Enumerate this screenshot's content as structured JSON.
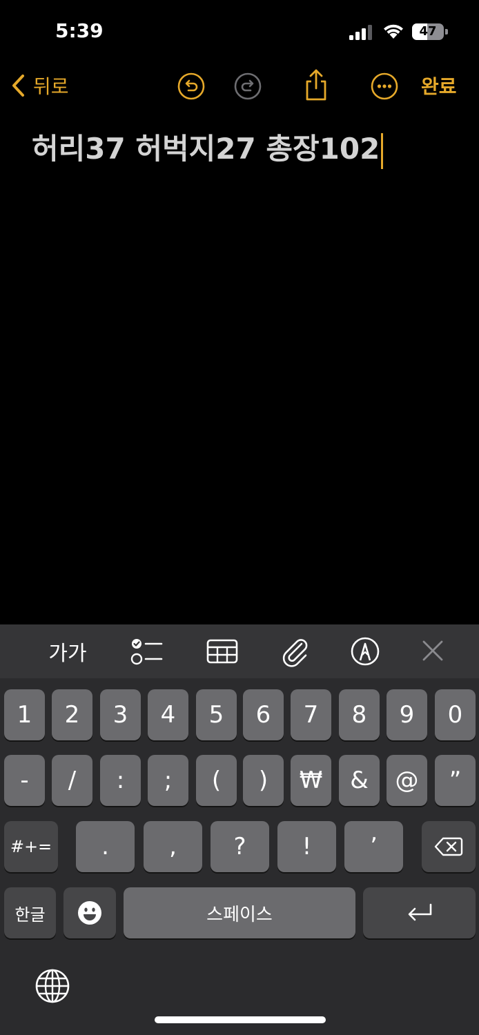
{
  "status_bar": {
    "time": "5:39",
    "battery_percent": "47",
    "battery_level": 0.47
  },
  "nav": {
    "back_label": "뒤로",
    "done_label": "완료",
    "accent_color": "#e6a92a"
  },
  "note": {
    "text": "허리37 허벅지27 총장102"
  },
  "toolbar": {
    "format_label": "가가",
    "icons": [
      "text-format-icon",
      "checklist-icon",
      "table-icon",
      "attachment-icon",
      "markup-pen-icon",
      "close-icon"
    ]
  },
  "keyboard": {
    "row1": [
      "1",
      "2",
      "3",
      "4",
      "5",
      "6",
      "7",
      "8",
      "9",
      "0"
    ],
    "row2": [
      "-",
      "/",
      ":",
      ";",
      "(",
      ")",
      "₩",
      "&",
      "@",
      "”"
    ],
    "row3_toggle": "#+=",
    "row3": [
      ".",
      ",",
      "?",
      "!",
      "’"
    ],
    "language": "한글",
    "space": "스페이스"
  }
}
